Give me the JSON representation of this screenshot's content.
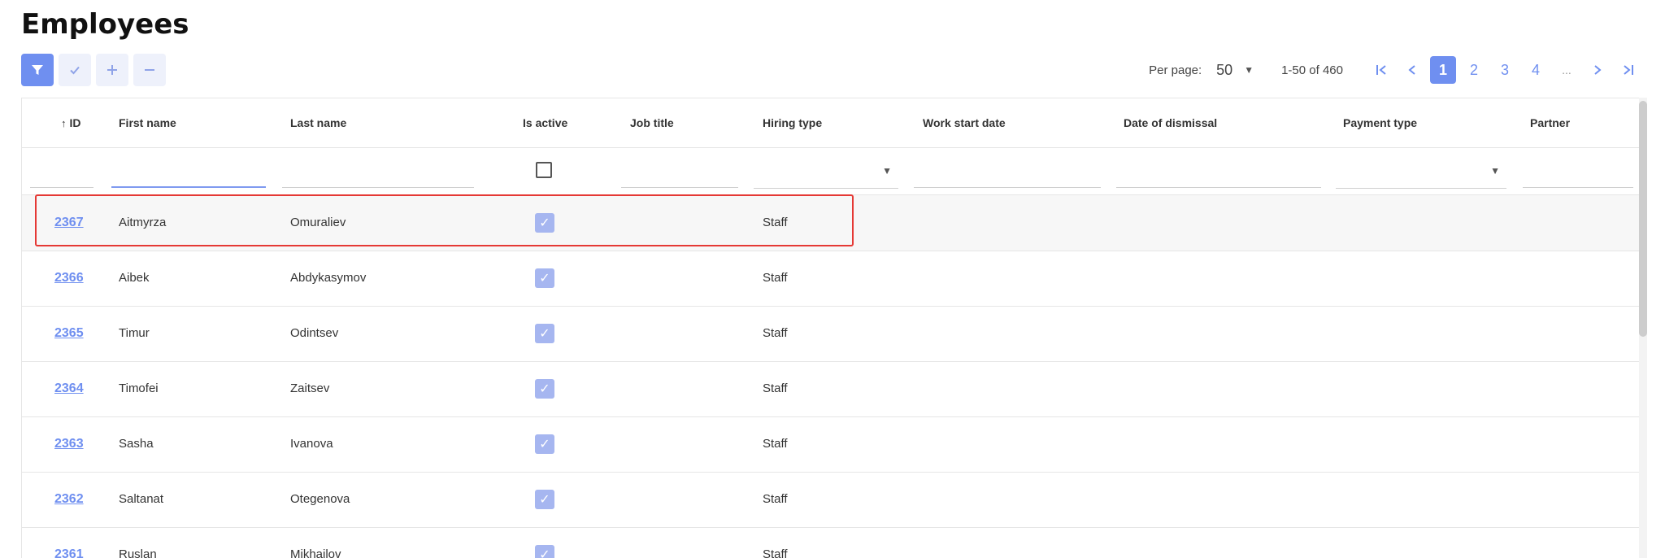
{
  "page": {
    "title": "Employees"
  },
  "toolbar": {
    "filter_icon": "filter-icon",
    "check_icon": "check-icon",
    "add_icon": "plus-icon",
    "remove_icon": "minus-icon"
  },
  "pager": {
    "per_page_label": "Per page:",
    "per_page_value": "50",
    "range": "1-50 of 460",
    "pages": [
      "1",
      "2",
      "3",
      "4",
      "..."
    ],
    "active_page": "1"
  },
  "columns": {
    "id": "ID",
    "first_name": "First name",
    "last_name": "Last name",
    "is_active": "Is active",
    "job_title": "Job title",
    "hiring_type": "Hiring type",
    "work_start_date": "Work start date",
    "date_of_dismissal": "Date of dismissal",
    "payment_type": "Payment type",
    "partner": "Partner"
  },
  "sort": {
    "column": "id",
    "direction": "asc"
  },
  "rows": [
    {
      "id": "2367",
      "first_name": "Aitmyrza",
      "last_name": "Omuraliev",
      "is_active": true,
      "job_title": "",
      "hiring_type": "Staff"
    },
    {
      "id": "2366",
      "first_name": "Aibek",
      "last_name": "Abdykasymov",
      "is_active": true,
      "job_title": "",
      "hiring_type": "Staff"
    },
    {
      "id": "2365",
      "first_name": "Timur",
      "last_name": "Odintsev",
      "is_active": true,
      "job_title": "",
      "hiring_type": "Staff"
    },
    {
      "id": "2364",
      "first_name": "Timofei",
      "last_name": "Zaitsev",
      "is_active": true,
      "job_title": "",
      "hiring_type": "Staff"
    },
    {
      "id": "2363",
      "first_name": "Sasha",
      "last_name": "Ivanova",
      "is_active": true,
      "job_title": "",
      "hiring_type": "Staff"
    },
    {
      "id": "2362",
      "first_name": "Saltanat",
      "last_name": "Otegenova",
      "is_active": true,
      "job_title": "",
      "hiring_type": "Staff"
    },
    {
      "id": "2361",
      "first_name": "Ruslan",
      "last_name": "Mikhailov",
      "is_active": true,
      "job_title": "",
      "hiring_type": "Staff"
    }
  ],
  "colors": {
    "accent": "#6f8ff0",
    "checkbox": "#a6b6f0",
    "highlight": "#e53935"
  }
}
